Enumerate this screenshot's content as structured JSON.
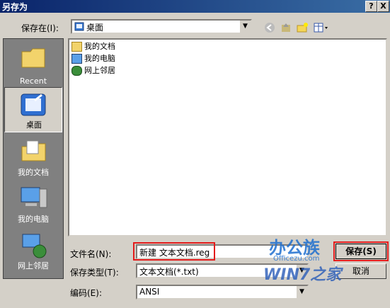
{
  "window": {
    "title": "另存为",
    "help_btn": "?",
    "close_btn": "X"
  },
  "toolbar": {
    "save_in_label": "保存在(I):",
    "save_in_value": "桌面"
  },
  "places": [
    {
      "label": "Recent"
    },
    {
      "label": "桌面"
    },
    {
      "label": "我的文档"
    },
    {
      "label": "我的电脑"
    },
    {
      "label": "网上邻居"
    }
  ],
  "files": [
    {
      "name": "我的文档"
    },
    {
      "name": "我的电脑"
    },
    {
      "name": "网上邻居"
    }
  ],
  "form": {
    "filename_label": "文件名(N):",
    "filename_value": "新建 文本文档.reg",
    "filetype_label": "保存类型(T):",
    "filetype_value": "文本文档(*.txt)",
    "encoding_label": "编码(E):",
    "encoding_value": "ANSI"
  },
  "buttons": {
    "save": "保存(S)",
    "cancel": "取消"
  },
  "watermark": {
    "line1": "办公族",
    "line2": "Officezu.com",
    "line3": "WIN7之家"
  },
  "colors": {
    "titlebar": "#0a246a",
    "highlight": "#e31b1b",
    "face": "#d4d0c8"
  }
}
